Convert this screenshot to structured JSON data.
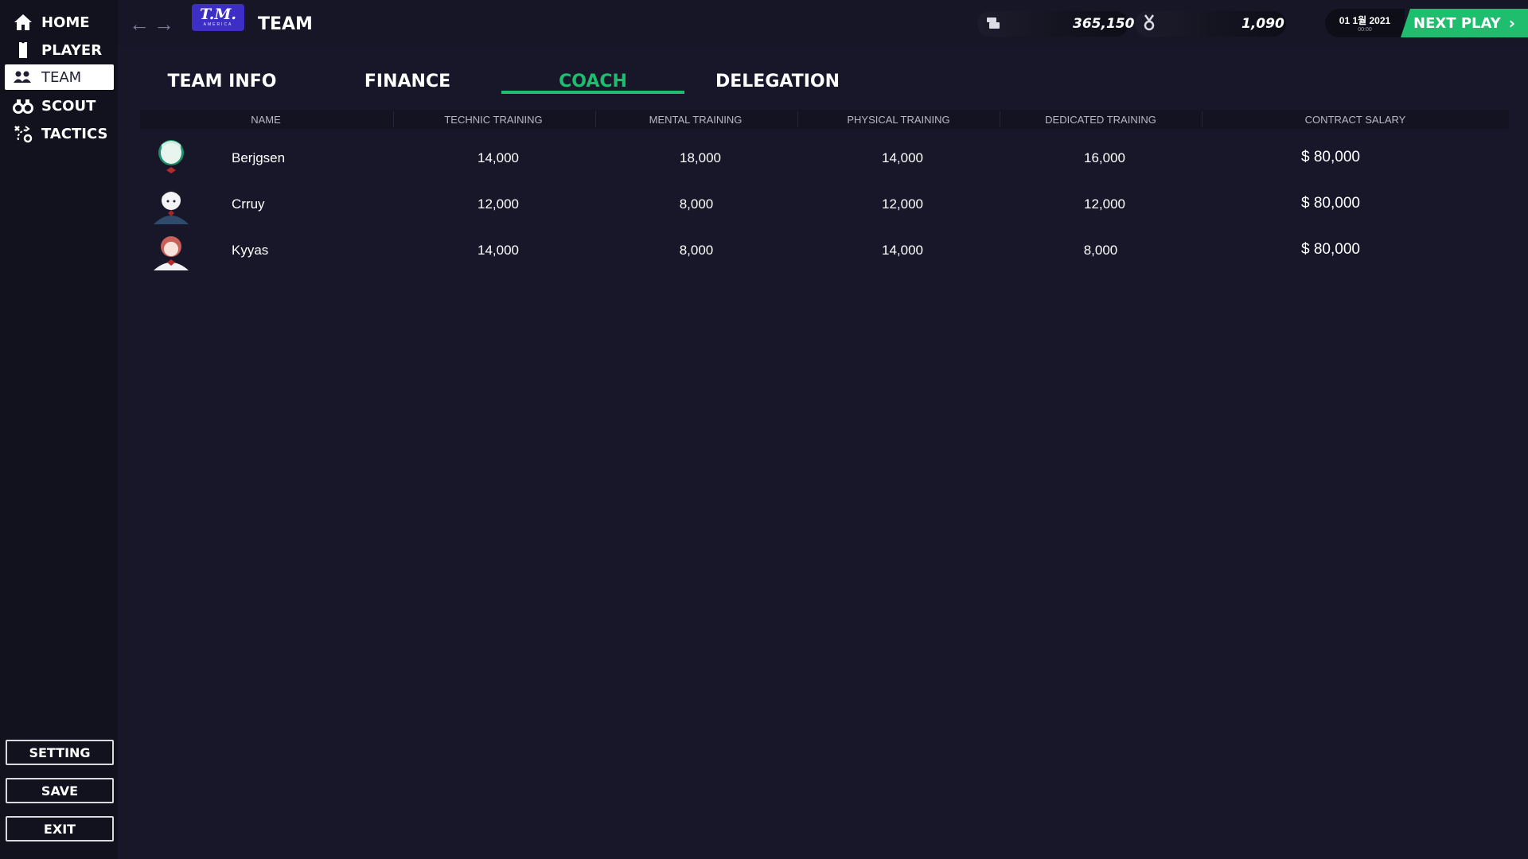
{
  "sidebar": {
    "items": [
      {
        "label": "HOME",
        "icon": "home-icon"
      },
      {
        "label": "PLAYER",
        "icon": "shirt-icon"
      },
      {
        "label": "TEAM",
        "icon": "group-icon",
        "active": true
      },
      {
        "label": "SCOUT",
        "icon": "binoculars-icon"
      },
      {
        "label": "TACTICS",
        "icon": "tactics-icon"
      }
    ],
    "system": {
      "setting": "SETTING",
      "save": "SAVE",
      "exit": "EXIT"
    }
  },
  "header": {
    "logo_text": "T.M.",
    "logo_sub": "AMERICA",
    "title": "TEAM",
    "currency_value": "365,150",
    "medal_value": "1,090",
    "date": "01 1월 2021",
    "time": "00:00",
    "next_play": "NEXT PLAY"
  },
  "tabs": [
    {
      "label": "TEAM INFO"
    },
    {
      "label": "FINANCE"
    },
    {
      "label": "COACH",
      "active": true
    },
    {
      "label": "DELEGATION"
    }
  ],
  "table": {
    "columns": [
      "NAME",
      "TECHNIC TRAINING",
      "MENTAL TRAINING",
      "PHYSICAL TRAINING",
      "DEDICATED TRAINING",
      "CONTRACT SALARY"
    ],
    "rows": [
      {
        "name": "Berjgsen",
        "technic": "14,000",
        "mental": "18,000",
        "physical": "14,000",
        "dedicated": "16,000",
        "salary": "$ 80,000"
      },
      {
        "name": "Crruy",
        "technic": "12,000",
        "mental": "8,000",
        "physical": "12,000",
        "dedicated": "12,000",
        "salary": "$ 80,000"
      },
      {
        "name": "Kyyas",
        "technic": "14,000",
        "mental": "8,000",
        "physical": "14,000",
        "dedicated": "8,000",
        "salary": "$ 80,000"
      }
    ]
  },
  "colors": {
    "accent": "#1fbd6e",
    "background": "#171729",
    "logo": "#3d2fc6"
  }
}
